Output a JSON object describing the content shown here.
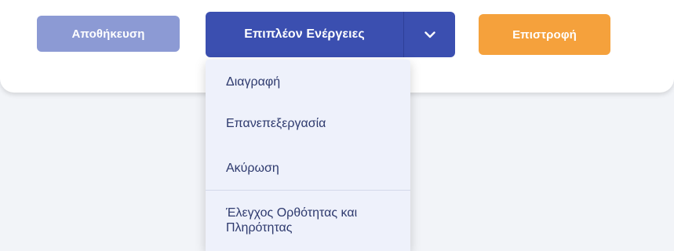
{
  "toolbar": {
    "save_label": "Αποθήκευση",
    "more_actions_label": "Επιπλέον Ενέργειες",
    "return_label": "Επιστροφή"
  },
  "dropdown": {
    "items": [
      {
        "label": "Διαγραφή"
      },
      {
        "label": "Επανεπεξεργασία"
      },
      {
        "label": "Ακύρωση"
      },
      {
        "label": "Έλεγχος Ορθότητας και Πληρότητας"
      }
    ]
  },
  "colors": {
    "save_button": "#8c9ad4",
    "more_actions_button": "#3b4fb0",
    "return_button": "#f5a13c",
    "menu_text": "#2e3a6e",
    "menu_background": "#eef1fb"
  },
  "icons": {
    "dropdown_toggle": "chevron-down-icon"
  }
}
